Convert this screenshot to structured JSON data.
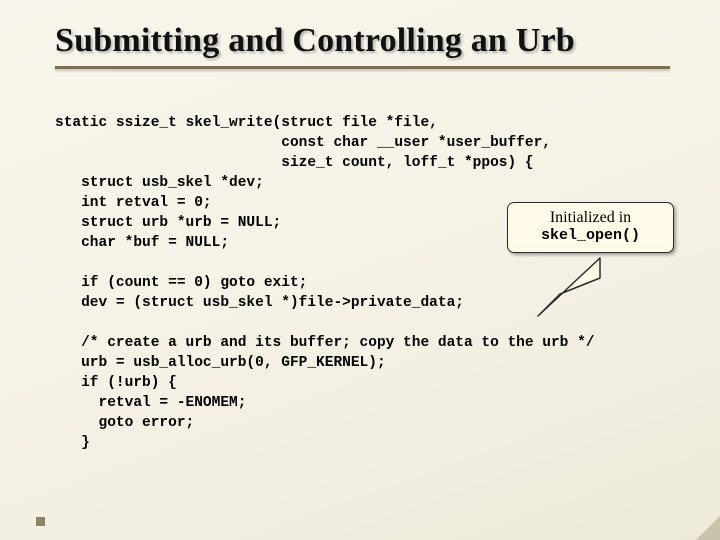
{
  "title": "Submitting and Controlling an Urb",
  "code_block1": "static ssize_t skel_write(struct file *file,\n                          const char __user *user_buffer,\n                          size_t count, loff_t *ppos) {\n   struct usb_skel *dev;\n   int retval = 0;\n   struct urb *urb = NULL;\n   char *buf = NULL;",
  "code_block2": "   if (count == 0) goto exit;\n   dev = (struct usb_skel *)file->private_data;",
  "code_block3": "   /* create a urb and its buffer; copy the data to the urb */\n   urb = usb_alloc_urb(0, GFP_KERNEL);\n   if (!urb) {\n     retval = -ENOMEM;\n     goto error;\n   }",
  "callout": {
    "line1": "Initialized in",
    "line2": "skel_open()"
  }
}
